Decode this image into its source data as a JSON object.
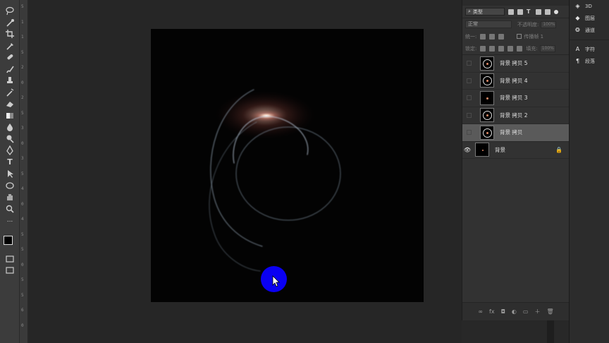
{
  "toolbar": {
    "tools": [
      "lasso-icon",
      "quick-select-icon",
      "crop-icon",
      "eyedropper-icon",
      "healing-brush-icon",
      "brush-icon",
      "clone-stamp-icon",
      "history-brush-icon",
      "eraser-icon",
      "gradient-icon",
      "blur-icon",
      "dodge-icon",
      "pen-icon",
      "type-icon",
      "path-select-icon",
      "ellipse-icon",
      "hand-icon",
      "zoom-icon",
      "more-icon"
    ],
    "type_tool_glyph": "T",
    "more_glyph": "..."
  },
  "ruler": {
    "labels": [
      "5",
      "1",
      "1",
      "5",
      "2",
      "0",
      "2",
      "5",
      "3",
      "0",
      "3",
      "5",
      "4",
      "0",
      "4",
      "5",
      "5",
      "0",
      "5",
      "5",
      "6",
      "0"
    ]
  },
  "layers_panel": {
    "filter_label": "类型",
    "type_filter_glyph": "T",
    "blend_mode": "正常",
    "opacity_label": "不透明度:",
    "opacity_value": "100%",
    "unify_label": "统一:",
    "propagate_label": "传播帧 1",
    "lock_label": "锁定:",
    "fill_label": "填充:",
    "fill_value": "100%",
    "layers": [
      {
        "name": "背景 拷贝 5",
        "visible": false,
        "selected": false,
        "locked": false
      },
      {
        "name": "背景 拷贝 4",
        "visible": false,
        "selected": false,
        "locked": false
      },
      {
        "name": "背景 拷贝 3",
        "visible": false,
        "selected": false,
        "locked": false
      },
      {
        "name": "背景 拷贝 2",
        "visible": false,
        "selected": false,
        "locked": false
      },
      {
        "name": "背景 拷贝",
        "visible": false,
        "selected": true,
        "locked": false
      },
      {
        "name": "背景",
        "visible": true,
        "selected": false,
        "locked": true
      }
    ],
    "eye_glyph": "👁",
    "lock_glyph": "🔒",
    "footer_icons": {
      "link": "∞",
      "fx": "fx",
      "mask": "◘",
      "adjustment": "◐",
      "group": "▭",
      "new": "＋",
      "delete": "🗑"
    }
  },
  "dock": {
    "items": [
      {
        "icon": "3d-icon",
        "label": "3D"
      },
      {
        "icon": "layers-icon",
        "label": "图层"
      },
      {
        "icon": "channels-icon",
        "label": "通道"
      },
      {
        "icon": "character-icon",
        "label": "字符"
      },
      {
        "icon": "paragraph-icon",
        "label": "段落"
      }
    ]
  },
  "colors": {
    "accent_cursor": "#0a00f2",
    "canvas_bg": "#030303",
    "workspace_bg": "#262626",
    "panel_bg": "#323232",
    "selected_layer": "#5a5a5a"
  }
}
